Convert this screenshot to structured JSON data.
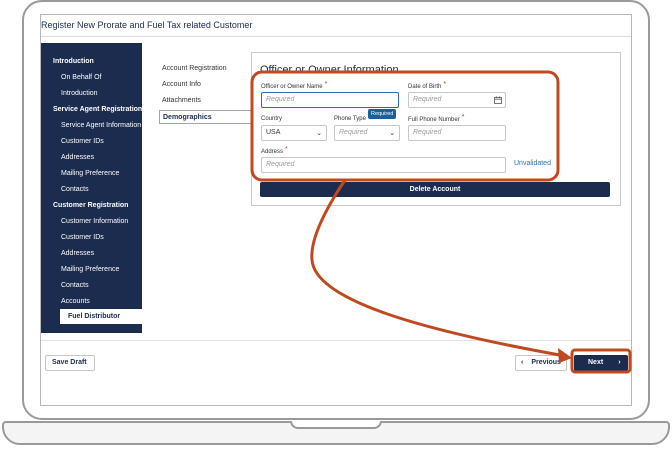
{
  "window": {
    "title": "Register New Prorate and Fuel Tax related Customer"
  },
  "left_nav": {
    "items": [
      {
        "label": "Introduction",
        "kind": "head"
      },
      {
        "label": "On Behalf Of",
        "kind": "sub"
      },
      {
        "label": "Introduction",
        "kind": "sub"
      },
      {
        "label": "Service Agent Registration",
        "kind": "head"
      },
      {
        "label": "Service Agent Information",
        "kind": "sub"
      },
      {
        "label": "Customer IDs",
        "kind": "sub"
      },
      {
        "label": "Addresses",
        "kind": "sub"
      },
      {
        "label": "Mailing Preference",
        "kind": "sub"
      },
      {
        "label": "Contacts",
        "kind": "sub"
      },
      {
        "label": "Customer Registration",
        "kind": "head"
      },
      {
        "label": "Customer Information",
        "kind": "sub"
      },
      {
        "label": "Customer IDs",
        "kind": "sub"
      },
      {
        "label": "Addresses",
        "kind": "sub"
      },
      {
        "label": "Mailing Preference",
        "kind": "sub"
      },
      {
        "label": "Contacts",
        "kind": "sub"
      },
      {
        "label": "Accounts",
        "kind": "sub"
      },
      {
        "label": "Fuel Distributor",
        "kind": "active"
      }
    ]
  },
  "sub_nav": {
    "items": [
      "Account Registration",
      "Account Info",
      "Attachments",
      "Demographics"
    ],
    "active_index": 3
  },
  "form": {
    "title": "Officer or Owner Information",
    "officer_name": {
      "label": "Officer or Owner Name",
      "placeholder": "Required",
      "tooltip": "Required"
    },
    "dob": {
      "label": "Date of Birth",
      "placeholder": "Required"
    },
    "country": {
      "label": "Country",
      "value": "USA"
    },
    "phone_type": {
      "label": "Phone Type",
      "placeholder": "Required"
    },
    "phone": {
      "label": "Full Phone Number",
      "placeholder": "Required"
    },
    "address": {
      "label": "Address",
      "placeholder": "Required",
      "status": "Unvalidated"
    },
    "delete_label": "Delete Account"
  },
  "footer": {
    "save_draft": "Save Draft",
    "previous": "Previous",
    "next": "Next",
    "prev_icon": "‹",
    "next_icon": "›"
  },
  "icons": {
    "calendar": "calendar-icon",
    "chevron": "chevron-down-icon",
    "asterisk": "*"
  },
  "colors": {
    "navy": "#1b2c4e",
    "highlight": "#c04a1f",
    "required": "#c0392b",
    "link": "#2a6db0"
  }
}
